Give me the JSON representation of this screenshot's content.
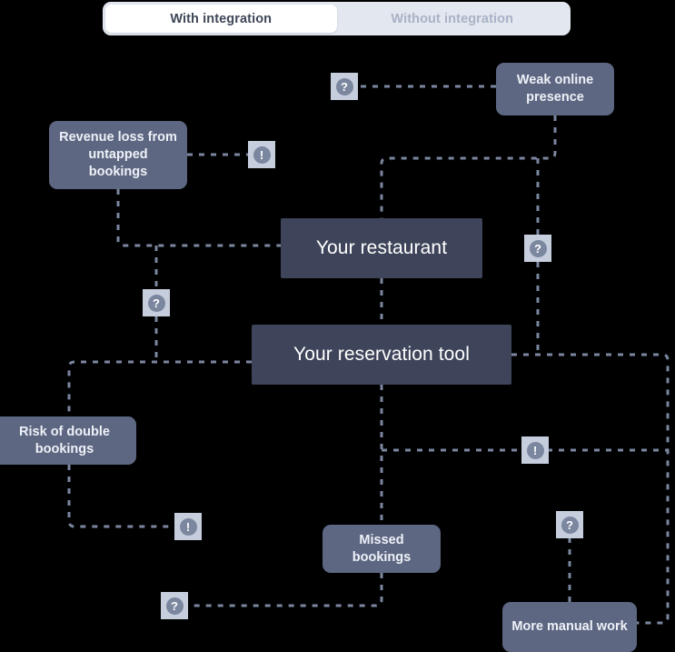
{
  "toggle": {
    "options": [
      {
        "label": "With integration",
        "state": "active"
      },
      {
        "label": "Without integration",
        "state": "inactive"
      }
    ]
  },
  "diagram": {
    "core_nodes": [
      {
        "id": "restaurant",
        "label": "Your restaurant"
      },
      {
        "id": "reservation-tool",
        "label": "Your reservation tool"
      }
    ],
    "outcome_nodes": [
      {
        "id": "weak-online-presence",
        "label": "Weak online presence"
      },
      {
        "id": "revenue-loss",
        "label": "Revenue loss from untapped bookings"
      },
      {
        "id": "risk-double-bookings",
        "label": "Risk of double bookings"
      },
      {
        "id": "missed-bookings",
        "label": "Missed bookings"
      },
      {
        "id": "more-manual-work",
        "label": "More manual work"
      }
    ],
    "badges": [
      {
        "id": "badge-question-top",
        "glyph": "?",
        "kind": "question"
      },
      {
        "id": "badge-alert-revenue",
        "glyph": "!",
        "kind": "alert"
      },
      {
        "id": "badge-question-right",
        "glyph": "?",
        "kind": "question"
      },
      {
        "id": "badge-question-left",
        "glyph": "?",
        "kind": "question"
      },
      {
        "id": "badge-alert-right",
        "glyph": "!",
        "kind": "alert"
      },
      {
        "id": "badge-alert-bottom-left",
        "glyph": "!",
        "kind": "alert"
      },
      {
        "id": "badge-question-manual",
        "glyph": "?",
        "kind": "question"
      },
      {
        "id": "badge-question-bottom",
        "glyph": "?",
        "kind": "question"
      }
    ],
    "colors": {
      "background": "#000000",
      "core_node": "#3e455a",
      "outcome_node": "#5d6782",
      "connector": "#7b869f",
      "badge_square": "#c6cede",
      "badge_disc": "#7b869f",
      "toggle_track": "#e3e7ef",
      "toggle_active": "#ffffff",
      "toggle_active_text": "#3f4758",
      "toggle_inactive_text": "#a9b2c6"
    }
  }
}
